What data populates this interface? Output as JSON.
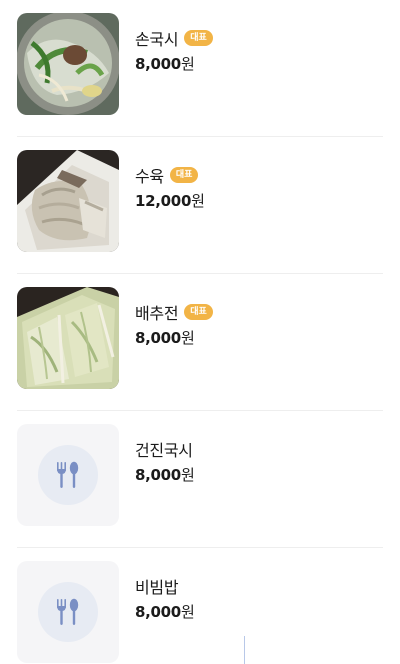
{
  "menu": {
    "items": [
      {
        "name": "손국시",
        "badge": "대표",
        "price": "8,000",
        "currency": "원",
        "image": "noodle-soup-photo"
      },
      {
        "name": "수육",
        "badge": "대표",
        "price": "12,000",
        "currency": "원",
        "image": "boiled-pork-photo"
      },
      {
        "name": "배추전",
        "badge": "대표",
        "price": "8,000",
        "currency": "원",
        "image": "cabbage-pancake-photo"
      },
      {
        "name": "건진국시",
        "badge": "",
        "price": "8,000",
        "currency": "원",
        "image": "placeholder-utensils-icon"
      },
      {
        "name": "비빔밥",
        "badge": "",
        "price": "8,000",
        "currency": "원",
        "image": "placeholder-utensils-icon"
      }
    ]
  },
  "colors": {
    "badge": "#f2b446",
    "placeholder_bg": "#f5f5f7",
    "placeholder_circle": "#e7ebf3",
    "icon": "#7a8fc4"
  }
}
